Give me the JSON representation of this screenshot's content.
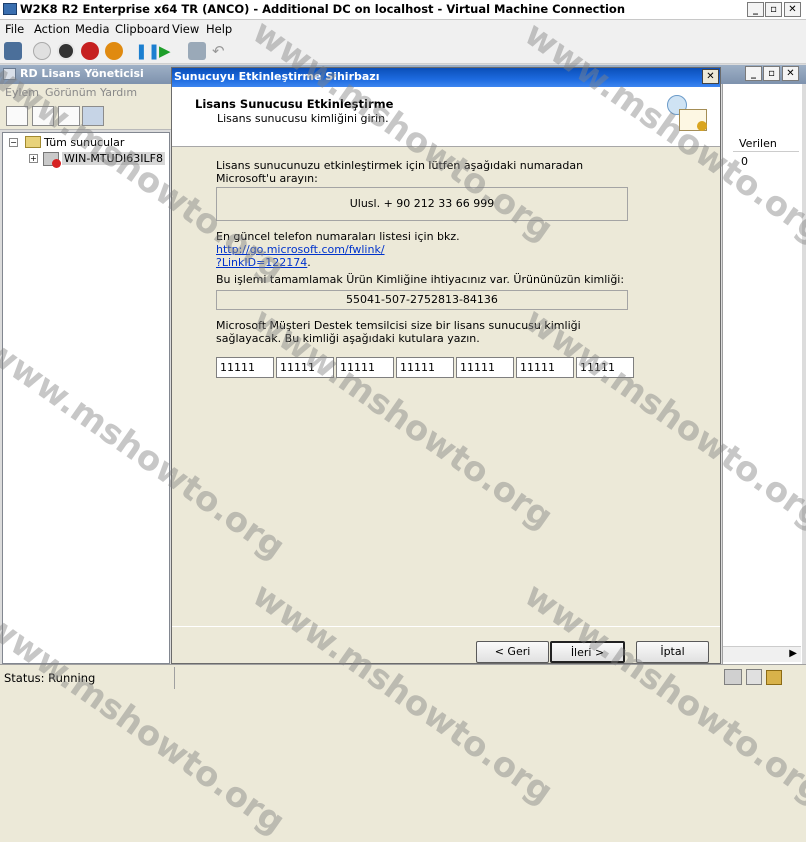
{
  "vm_window": {
    "title": "W2K8 R2 Enterprise x64 TR (ANCO) - Additional DC on localhost - Virtual Machine Connection",
    "menu": [
      "File",
      "Action",
      "Media",
      "Clipboard",
      "View",
      "Help"
    ],
    "status": "Status: Running"
  },
  "mmc": {
    "title": "RD Lisans Yöneticisi",
    "menu": [
      "Eylem",
      "Görünüm",
      "Yardım"
    ],
    "tree_root": "Tüm sunucular",
    "tree_server": "WIN-MTUDI63ILF8",
    "col_header": "Verilen",
    "col_value": "0"
  },
  "wizard": {
    "title": "Sunucuyu Etkinleştirme Sihirbazı",
    "heading": "Lisans Sunucusu Etkinleştirme",
    "subheading": "Lisans sunucusu kimliğini girin.",
    "call_text": "Lisans sunucunuzu etkinleştirmek için lütfen aşağıdaki numaradan Microsoft'u arayın:",
    "phone": "Ulusl. + 90 212 33 66 999",
    "link_prefix": "En güncel telefon numaraları listesi için bkz.",
    "link_line1": "http://go.microsoft.com/fwlink/",
    "link_line2": "?LinkID=122174",
    "link_suffix": ".",
    "product_text": "Bu işlemi tamamlamak Ürün Kimliğine ihtiyacınız var. Ürününüzün kimliği:",
    "product_id": "55041-507-2752813-84136",
    "support_text": "Microsoft Müşteri Destek temsilcisi size bir lisans sunucusu kimliği sağlayacak. Bu kimliği aşağıdaki kutulara yazın.",
    "id_boxes": [
      "11111",
      "11111",
      "11111",
      "11111",
      "11111",
      "11111",
      "11111"
    ],
    "btn_back": "< Geri",
    "btn_next": "İleri >",
    "btn_cancel": "İptal"
  },
  "watermark": "www.mshowto.org"
}
